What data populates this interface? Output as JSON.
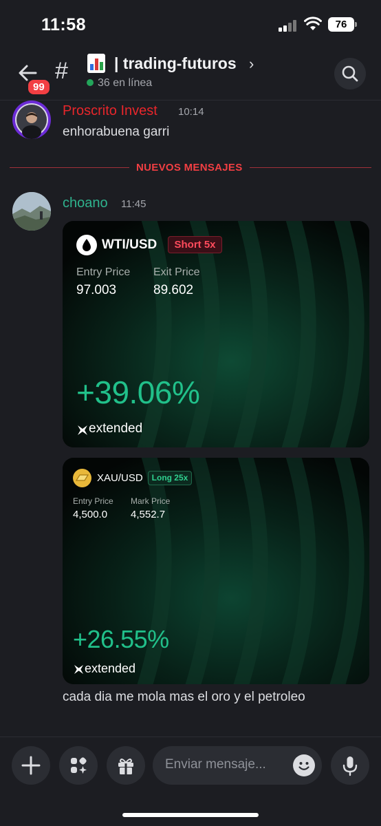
{
  "status_bar": {
    "time": "11:58",
    "battery": "76"
  },
  "header": {
    "badge_count": "99",
    "hash": "#",
    "channel_name": "| trading-futuros",
    "chevron": "›",
    "online_text": "36 en línea"
  },
  "messages": [
    {
      "author": "Proscrito Invest",
      "author_color": "#e8262b",
      "time": "10:14",
      "text": "enhorabuena garri"
    },
    {
      "author": "choano",
      "author_color": "#2fb38e",
      "time": "11:45",
      "text": "cada dia me mola mas el oro y el petroleo"
    }
  ],
  "divider": {
    "label": "NUEVOS MENSAJES"
  },
  "cards": [
    {
      "icon": "oil-drop-icon",
      "pair": "WTI/USD",
      "position": "Short 5x",
      "position_color": "#ff4b5c",
      "label1": "Entry Price",
      "value1": "97.003",
      "label2": "Exit Price",
      "value2": "89.602",
      "pnl": "+39.06%",
      "brand": "extended"
    },
    {
      "icon": "gold-bar-icon",
      "pair": "XAU/USD",
      "position": "Long 25x",
      "position_color": "#2fd08f",
      "label1": "Entry Price",
      "value1": "4,500.0",
      "label2": "Mark Price",
      "value2": "4,552.7",
      "pnl": "+26.55%",
      "brand": "extended"
    }
  ],
  "composer": {
    "placeholder": "Enviar mensaje..."
  }
}
